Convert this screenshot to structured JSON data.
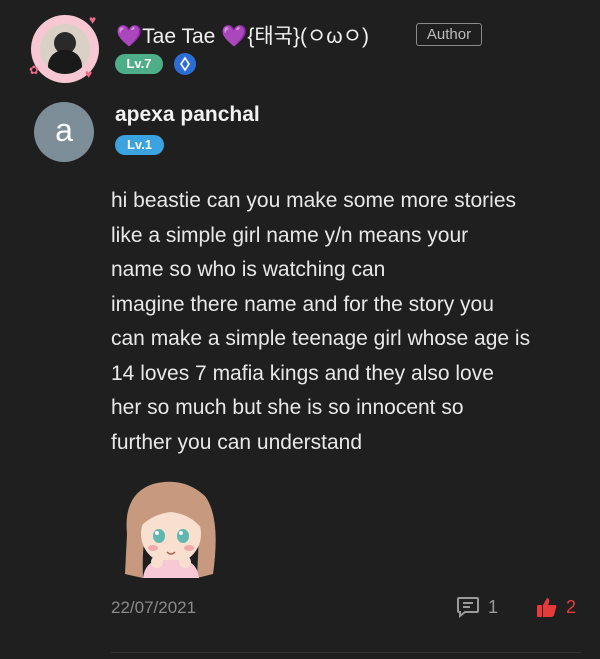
{
  "author": {
    "name_prefix_heart": "💜",
    "name": "Tae Tae",
    "name_suffix_heart": "💜",
    "name_tail": "{태국}(ㅇωㅇ)",
    "role_badge": "Author",
    "level": "Lv.7"
  },
  "comment": {
    "avatar_letter": "a",
    "username": "apexa panchal",
    "level": "Lv.1",
    "text_lines": [
      "hi beastie can you make some more stories",
      "like  a simple girl name y/n means your",
      "name so who is watching can",
      "imagine there name and for the story you",
      "can make a simple teenage girl whose age is",
      "14 loves 7 mafia kings and they also love",
      "her so much but she is so innocent so",
      "further you can understand"
    ],
    "date": "22/07/2021",
    "reply_count": "1",
    "like_count": "2"
  },
  "colors": {
    "background": "#1f1f1f",
    "like_red": "#e53b3b",
    "author_level_green": "#4fae8a",
    "commenter_level_blue": "#3aa3e0",
    "heart_purple": "#8a4bd8"
  },
  "icons": {
    "reply": "comment-icon",
    "like": "thumbs-up-icon",
    "ring": "ring-badge-icon"
  }
}
